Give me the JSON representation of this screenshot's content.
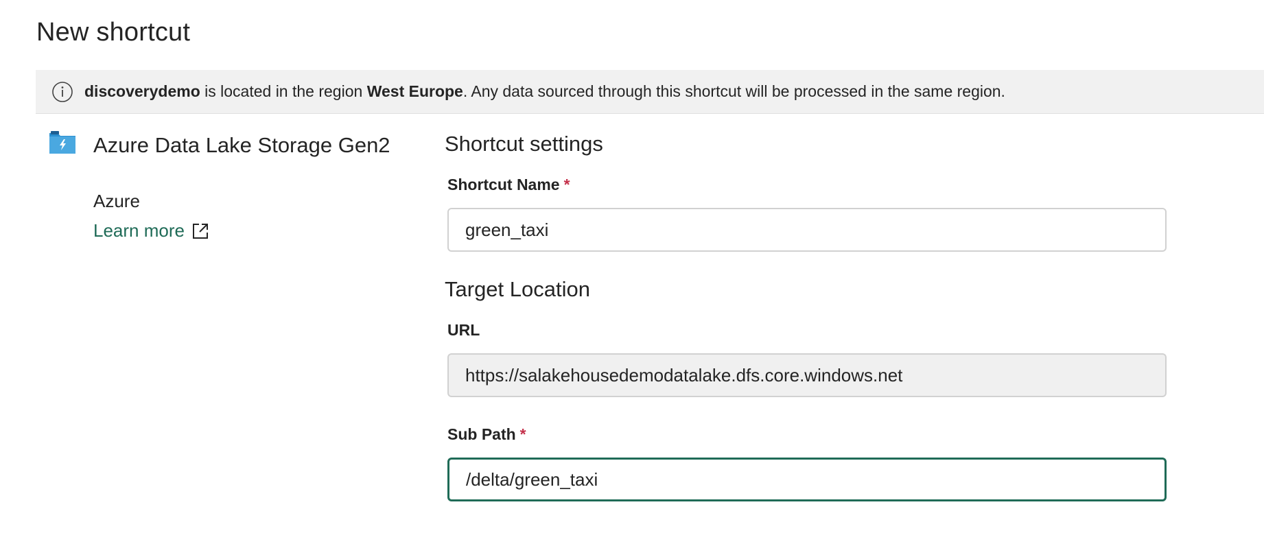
{
  "dialog": {
    "title": "New shortcut"
  },
  "banner": {
    "workspace": "discoverydemo",
    "text_1": " is located in the region ",
    "region": "West Europe",
    "text_2": ". Any data sourced through this shortcut will be processed in the same region.",
    "icon": "info-icon"
  },
  "source": {
    "icon": "adls-folder-icon",
    "name": "Azure Data Lake Storage Gen2",
    "provider": "Azure",
    "learn_more": "Learn more",
    "accent": "#1f6b57"
  },
  "settings": {
    "heading": "Shortcut settings",
    "shortcut_name_label": "Shortcut Name",
    "shortcut_name_value": "green_taxi",
    "required_mark": "*"
  },
  "target": {
    "heading": "Target Location",
    "url_label": "URL",
    "url_value": "https://salakehousedemodatalake.dfs.core.windows.net",
    "sub_path_label": "Sub Path",
    "sub_path_value": "/delta/green_taxi",
    "required_mark": "*"
  }
}
